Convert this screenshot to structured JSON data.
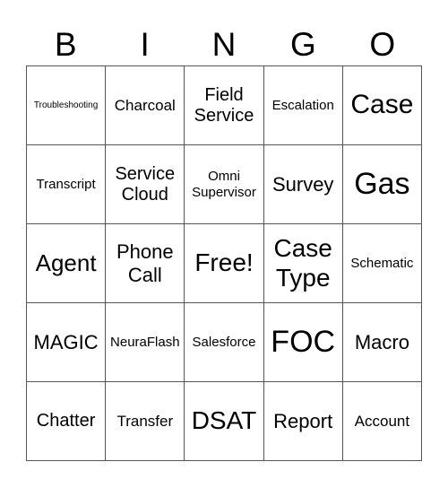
{
  "header": [
    "B",
    "I",
    "N",
    "G",
    "O"
  ],
  "rows": [
    [
      "Troubleshooting",
      "Charcoal",
      "Field Service",
      "Escalation",
      "Case"
    ],
    [
      "Transcript",
      "Service Cloud",
      "Omni Supervisor",
      "Survey",
      "Gas"
    ],
    [
      "Agent",
      "Phone Call",
      "Free!",
      "Case Type",
      "Schematic"
    ],
    [
      "MAGIC",
      "NeuraFlash",
      "Salesforce",
      "FOC",
      "Macro"
    ],
    [
      "Chatter",
      "Transfer",
      "DSAT",
      "Report",
      "Account"
    ]
  ]
}
